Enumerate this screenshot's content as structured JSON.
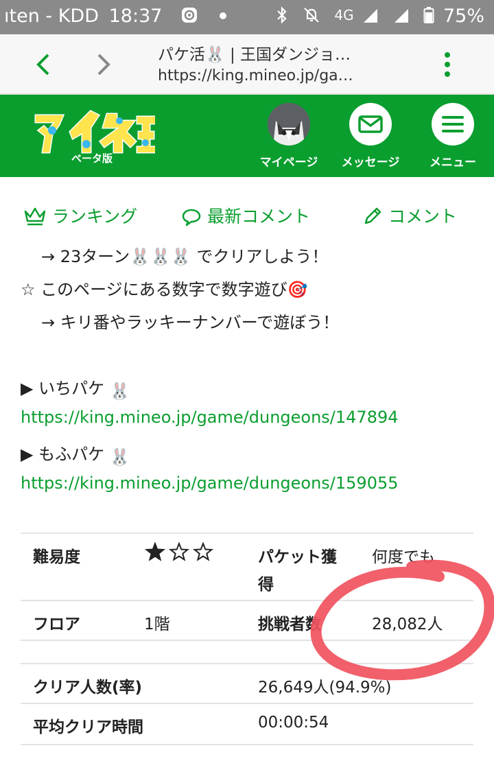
{
  "status_bar": {
    "carrier": "ıten - KDD",
    "time": "18:37",
    "network": "4G",
    "battery": "75%"
  },
  "browser": {
    "page_title": "パケ活🐰 | 王国ダンジョ…",
    "url": "https://king.mineo.jp/ga…"
  },
  "header": {
    "logo_text": "マイネ王",
    "logo_sub": "ベータ版",
    "mypage_label": "マイページ",
    "message_label": "メッセージ",
    "menu_label": "メニュー",
    "accent_color": "#0a9e2f"
  },
  "subnav": {
    "ranking": "ランキング",
    "latest_comment": "最新コメント",
    "comment": "コメント"
  },
  "content": {
    "line1": "→ 23ターン🐰🐰🐰 でクリアしよう！",
    "line2": "☆ このページにある数字で数字遊び🎯",
    "line3": "→ キリ番やラッキーナンバーで遊ぼう！",
    "ichi_label": "▶ いちパケ",
    "ichi_url": "https://king.mineo.jp/game/dungeons/147894",
    "mofu_label": "▶ もふパケ",
    "mofu_url": "https://king.mineo.jp/game/dungeons/159055"
  },
  "stats": {
    "difficulty_label": "難易度",
    "difficulty_rating": 1,
    "difficulty_max": 3,
    "packet_label_1": "パケット獲",
    "packet_label_2": "得",
    "packet_value": "何度でも",
    "floor_label": "フロア",
    "floor_value": "1階",
    "challengers_label": "挑戦者数",
    "challengers_value": "28,082人",
    "clear_label": "クリア人数(率)",
    "clear_value": "26,649人(94.9%)",
    "avg_time_label": "平均クリア時間",
    "avg_time_value": "00:00:54"
  }
}
